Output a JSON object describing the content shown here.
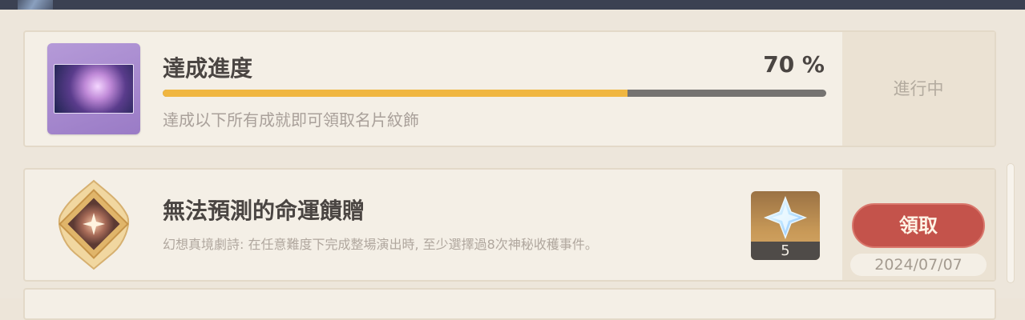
{
  "progress": {
    "title": "達成進度",
    "percent_text": "70 %",
    "fraction": 0.7,
    "description": "達成以下所有成就即可領取名片紋飾",
    "status": "進行中",
    "thumbnail_icon": "namecard-thumbnail-icon"
  },
  "achievement": {
    "title": "無法預測的命運饋贈",
    "description": "幻想真境劇詩: 在任意難度下完成整場演出時, 至少選擇過8次神秘收穫事件。",
    "badge_icon": "achievement-badge-icon",
    "reward": {
      "icon": "primogem-icon",
      "count": "5"
    },
    "claim_label": "領取",
    "date": "2024/07/07"
  },
  "colors": {
    "accent_gold": "#f0b640",
    "claim_red": "#c4534b",
    "text_dark": "#4a4542"
  }
}
